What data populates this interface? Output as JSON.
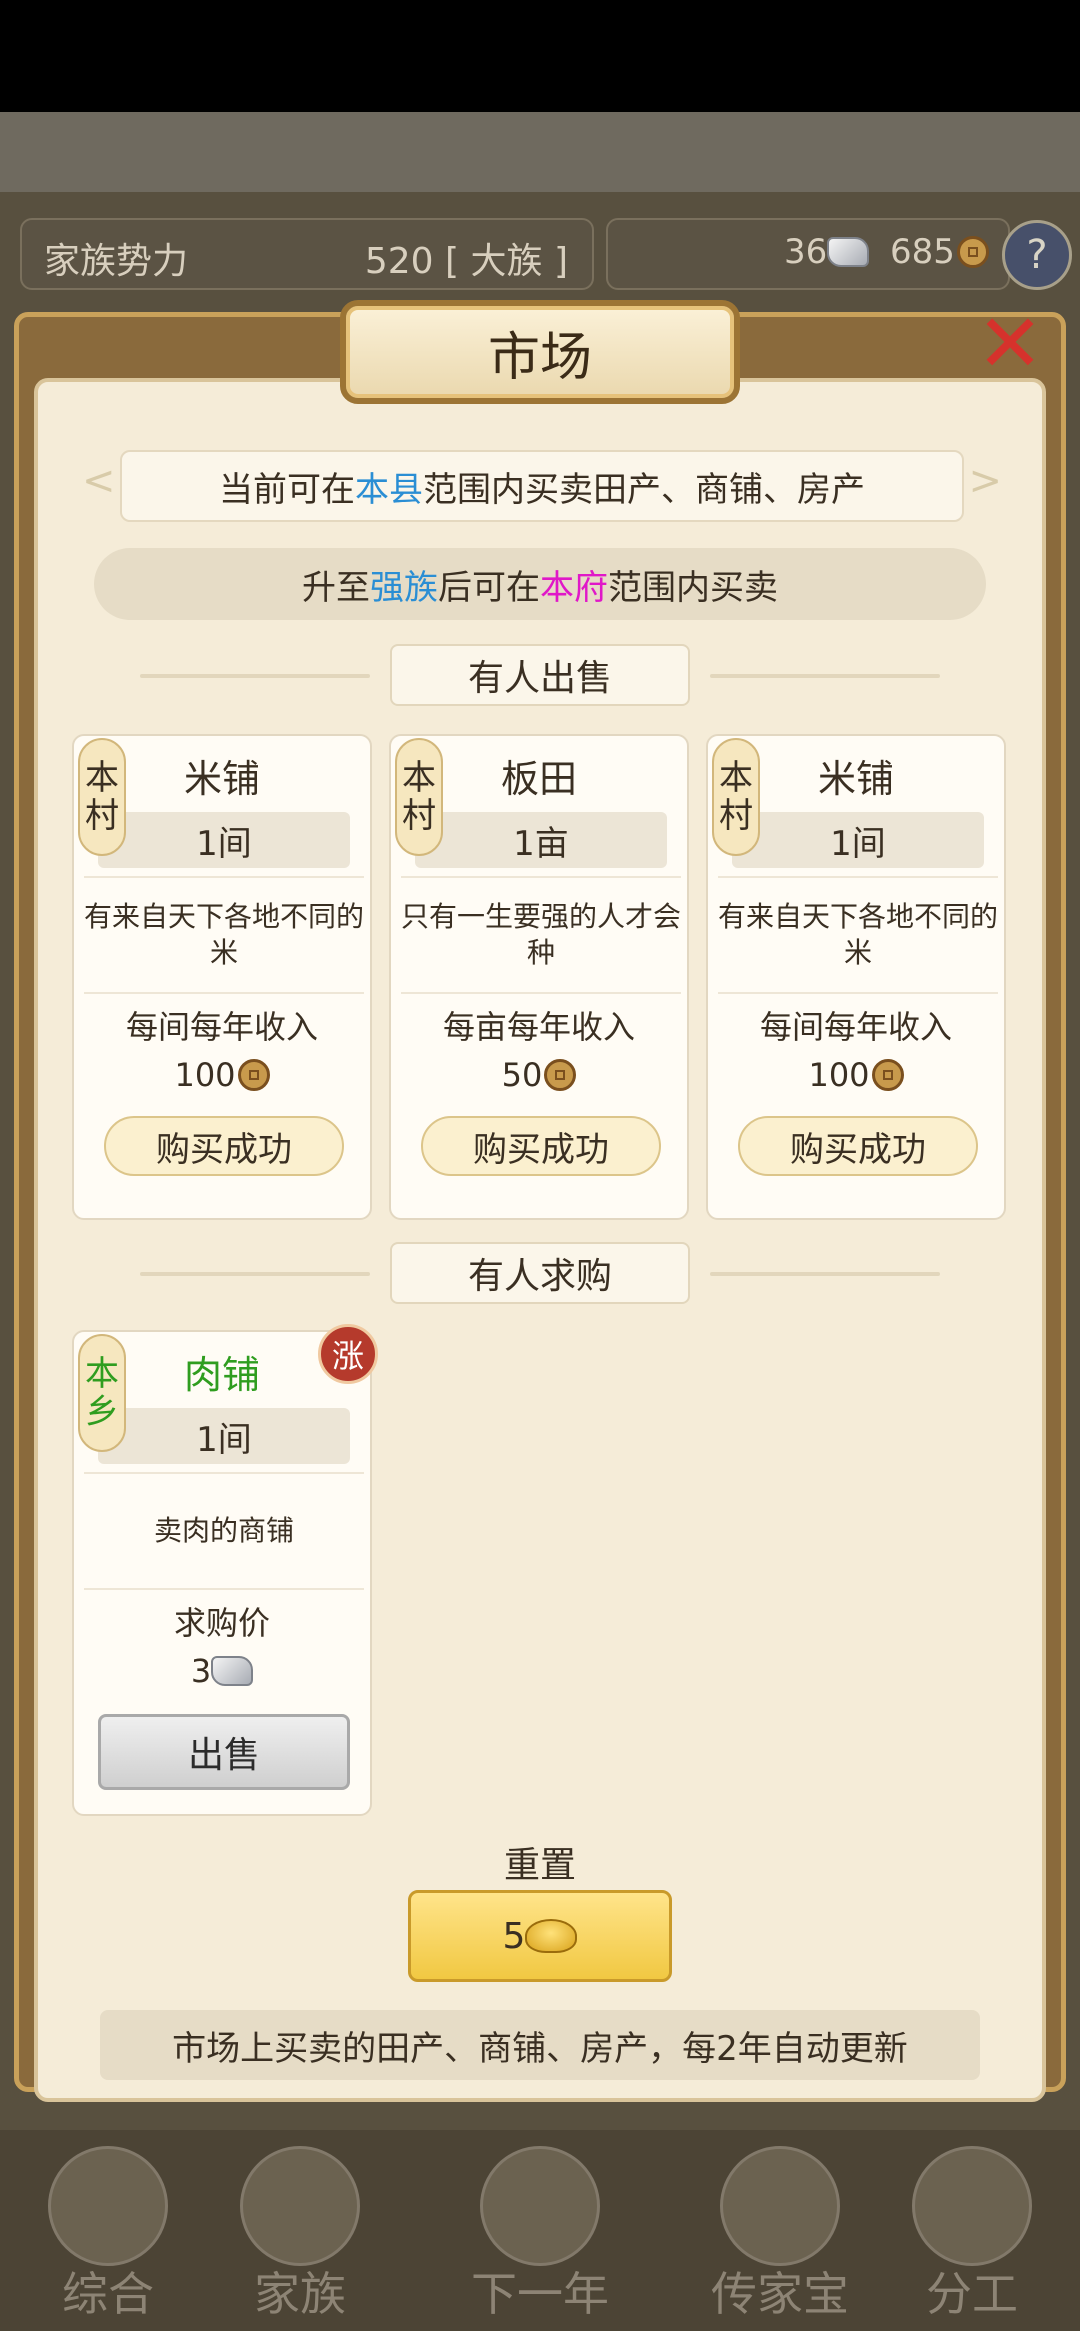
{
  "topbar": {
    "family_power_label": "家族势力",
    "family_power_value": "520 [ 大族 ]",
    "silver": "36",
    "copper": "685",
    "help": "?"
  },
  "dialog": {
    "title": "市场",
    "close": "✕",
    "info_prefix": "当前可在",
    "info_region": "本县",
    "info_suffix": "范围内买卖田产、商铺、房产",
    "upgrade_prefix": "升至",
    "upgrade_clan": "强族",
    "upgrade_mid": "后可在",
    "upgrade_region": "本府",
    "upgrade_suffix": "范围内买卖"
  },
  "for_sale": {
    "header": "有人出售",
    "items": [
      {
        "location": "本村",
        "name": "米铺",
        "qty": "1间",
        "desc": "有来自天下各地不同的米",
        "income_label": "每间每年收入",
        "income": "100",
        "button": "购买成功"
      },
      {
        "location": "本村",
        "name": "板田",
        "qty": "1亩",
        "desc": "只有一生要强的人才会种",
        "income_label": "每亩每年收入",
        "income": "50",
        "button": "购买成功"
      },
      {
        "location": "本村",
        "name": "米铺",
        "qty": "1间",
        "desc": "有来自天下各地不同的米",
        "income_label": "每间每年收入",
        "income": "100",
        "button": "购买成功"
      }
    ]
  },
  "wanted": {
    "header": "有人求购",
    "items": [
      {
        "location": "本乡",
        "name": "肉铺",
        "qty": "1间",
        "badge": "涨",
        "desc": "卖肉的商铺",
        "price_label": "求购价",
        "price": "3",
        "button": "出售"
      }
    ]
  },
  "reset": {
    "label": "重置",
    "cost": "5"
  },
  "footer_note": "市场上买卖的田产、商铺、房产，每2年自动更新",
  "nav": [
    {
      "label": "综合",
      "icon": "scroll-icon"
    },
    {
      "label": "家族",
      "icon": "hall-icon"
    },
    {
      "label": "下一年",
      "icon": "mountain-icon"
    },
    {
      "label": "传家宝",
      "icon": "treasure-icon"
    },
    {
      "label": "分工",
      "icon": "people-icon"
    }
  ],
  "colors": {
    "accent_blue": "#2a8ed4",
    "accent_pink": "#e018c8",
    "green_text": "#2f9d1f",
    "rise_badge": "#b53a2c"
  }
}
